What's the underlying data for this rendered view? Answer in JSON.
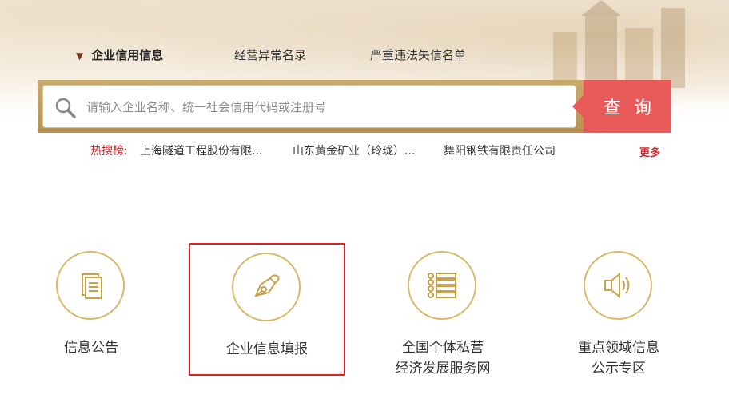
{
  "nav": {
    "tabs": [
      {
        "label": "企业信用信息",
        "active": true
      },
      {
        "label": "经营异常名录",
        "active": false
      },
      {
        "label": "严重违法失信名单",
        "active": false
      }
    ]
  },
  "search": {
    "placeholder": "请输入企业名称、统一社会信用代码或注册号",
    "value": "",
    "button_label": "查询"
  },
  "hot_search": {
    "label": "热搜榜:",
    "items": [
      "上海隧道工程股份有限...",
      "山东黄金矿业（玲珑）...",
      "舞阳钢铁有限责任公司"
    ],
    "more_label": "更多"
  },
  "cards": [
    {
      "label_line1": "信息公告",
      "label_line2": "",
      "icon": "document-icon"
    },
    {
      "label_line1": "企业信息填报",
      "label_line2": "",
      "icon": "pen-nib-icon",
      "selected": true
    },
    {
      "label_line1": "全国个体私营",
      "label_line2": "经济发展服务网",
      "icon": "list-icon"
    },
    {
      "label_line1": "重点领域信息",
      "label_line2": "公示专区",
      "icon": "speaker-icon"
    }
  ],
  "colors": {
    "accent_gold": "#d9b86a",
    "search_button": "#e8595a",
    "hot_red": "#d0262a",
    "selection_border": "#e02020"
  }
}
